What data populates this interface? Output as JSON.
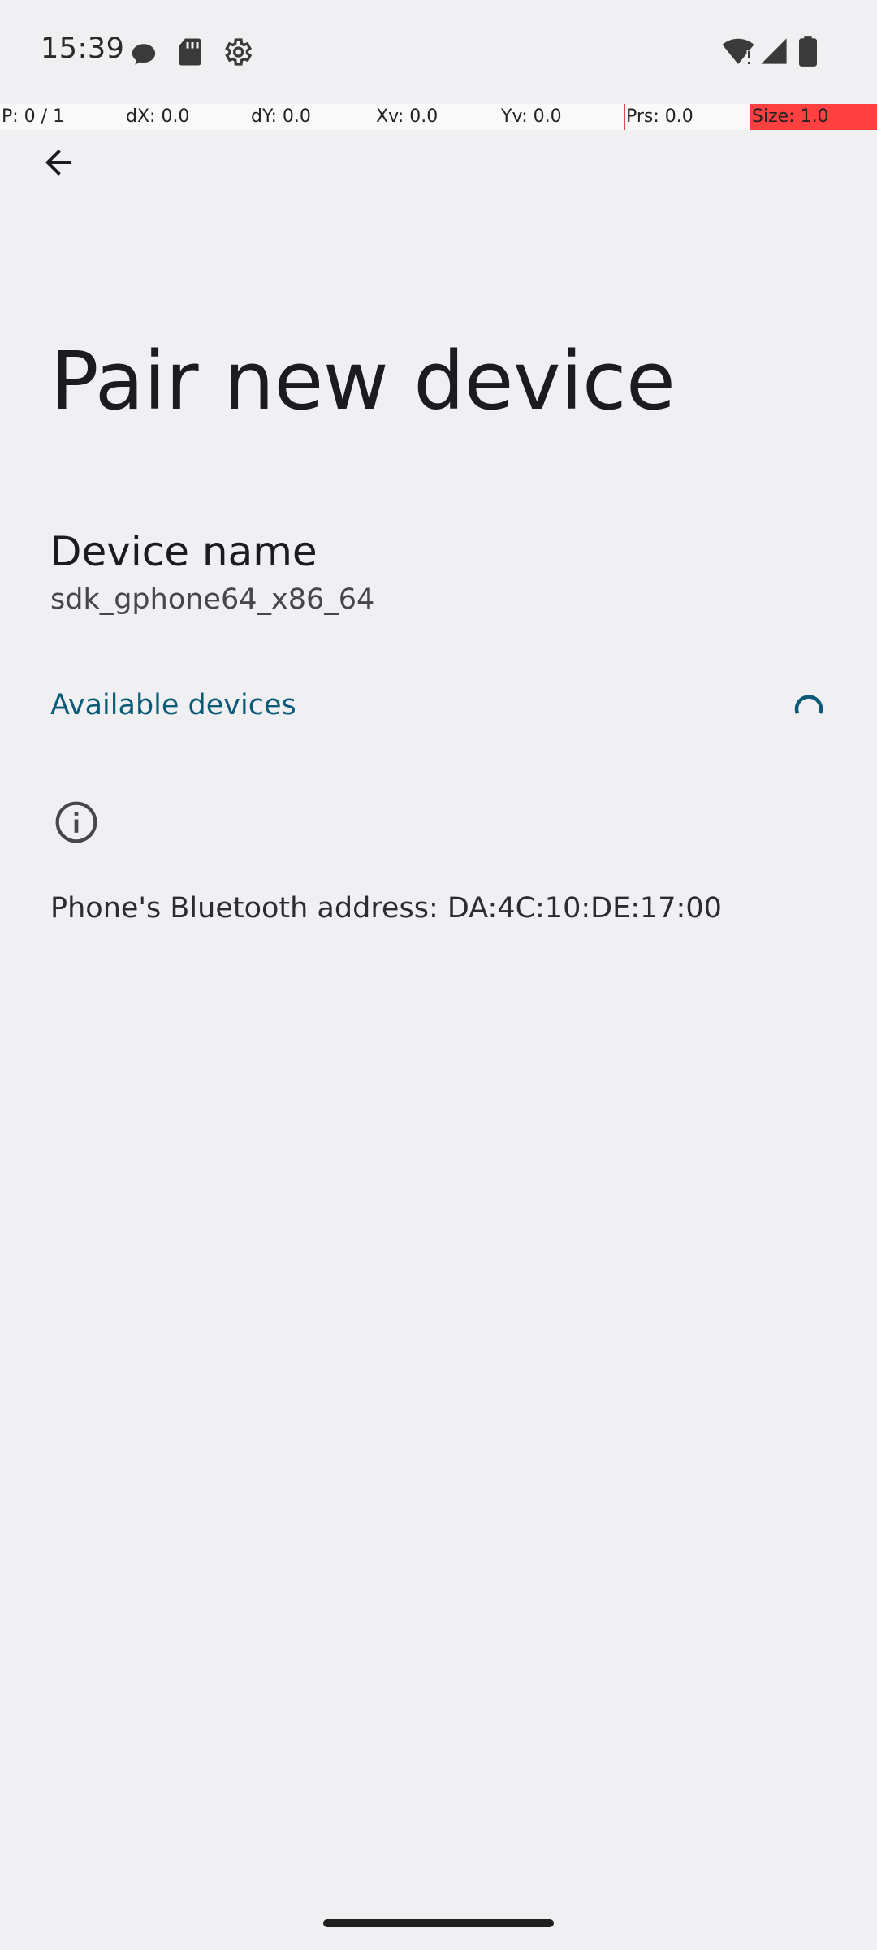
{
  "status_bar": {
    "time": "15:39",
    "icons_left": [
      "chat-bubble-icon",
      "sd-card-icon",
      "settings-gear-icon"
    ],
    "icons_right": [
      "wifi-alert-icon",
      "cell-signal-icon",
      "battery-icon"
    ]
  },
  "pointer_overlay": {
    "p": "P: 0 / 1",
    "dx": "dX: 0.0",
    "dy": "dY: 0.0",
    "xv": "Xv: 0.0",
    "yv": "Yv: 0.0",
    "prs": "Prs: 0.0",
    "size": "Size: 1.0"
  },
  "toolbar": {
    "back_icon": "arrow-back-icon"
  },
  "page": {
    "title": "Pair new device"
  },
  "device_name": {
    "title": "Device name",
    "value": "sdk_gphone64_x86_64"
  },
  "available_devices": {
    "title": "Available devices",
    "loading": true
  },
  "footer_info": {
    "icon": "info-icon",
    "bluetooth_address": "Phone's Bluetooth address: DA:4C:10:DE:17:00"
  },
  "colors": {
    "background": "#f0f0f3",
    "accent": "#0b5a78",
    "overlay_red": "#ff4040"
  }
}
